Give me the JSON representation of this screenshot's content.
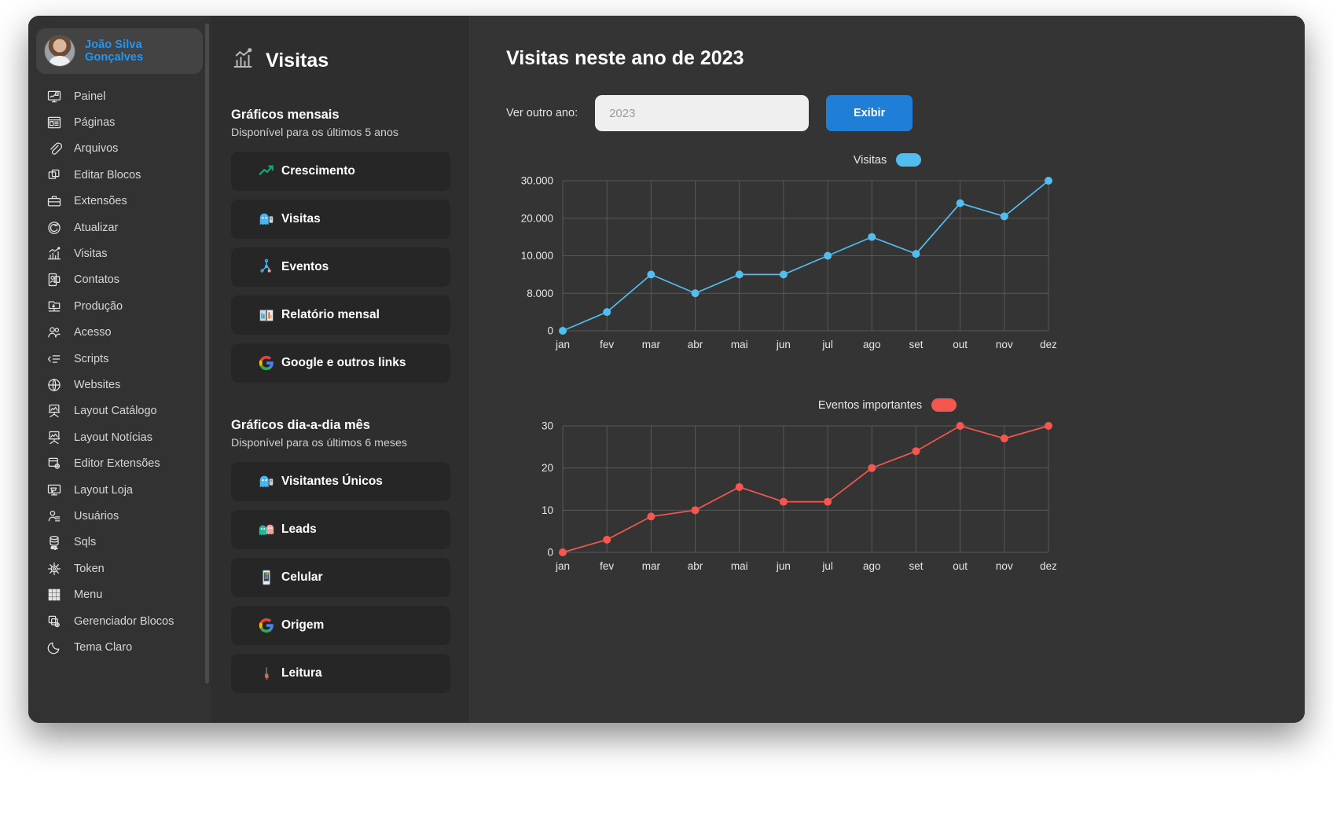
{
  "sidebar": {
    "profile": {
      "name": "João Silva Gonçalves",
      "avatar_alt": "user-avatar"
    },
    "items": [
      {
        "label": "Painel",
        "icon": "dashboard-icon"
      },
      {
        "label": "Páginas",
        "icon": "pages-icon"
      },
      {
        "label": "Arquivos",
        "icon": "paperclip-icon"
      },
      {
        "label": "Editar Blocos",
        "icon": "blocks-icon"
      },
      {
        "label": "Extensões",
        "icon": "toolbox-icon"
      },
      {
        "label": "Atualizar",
        "icon": "refresh-icon"
      },
      {
        "label": "Visitas",
        "icon": "chart-icon"
      },
      {
        "label": "Contatos",
        "icon": "contacts-icon"
      },
      {
        "label": "Produção",
        "icon": "production-icon"
      },
      {
        "label": "Acesso",
        "icon": "users-icon"
      },
      {
        "label": "Scripts",
        "icon": "code-icon"
      },
      {
        "label": "Websites",
        "icon": "globe-icon"
      },
      {
        "label": "Layout Catálogo",
        "icon": "easel-icon"
      },
      {
        "label": "Layout Notícias",
        "icon": "easel-news-icon"
      },
      {
        "label": "Editor Extensões",
        "icon": "extension-editor-icon"
      },
      {
        "label": "Layout Loja",
        "icon": "shop-icon"
      },
      {
        "label": "Usuários",
        "icon": "user-list-icon"
      },
      {
        "label": "Sqls",
        "icon": "database-icon"
      },
      {
        "label": "Token",
        "icon": "token-icon"
      },
      {
        "label": "Menu",
        "icon": "grid-icon"
      },
      {
        "label": "Gerenciador Blocos",
        "icon": "blocks-gear-icon"
      },
      {
        "label": "Tema Claro",
        "icon": "moon-icon"
      }
    ]
  },
  "mid": {
    "title": "Visitas",
    "title_icon": "chart-icon",
    "groups": [
      {
        "heading": "Gráficos mensais",
        "subheading": "Disponível para os últimos 5 anos",
        "buttons": [
          {
            "label": "Crescimento",
            "icon": "trend-up-icon"
          },
          {
            "label": "Visitas",
            "icon": "visitor-icon"
          },
          {
            "label": "Eventos",
            "icon": "events-icon"
          },
          {
            "label": "Relatório mensal",
            "icon": "report-icon"
          },
          {
            "label": "Google e outros links",
            "icon": "google-icon"
          }
        ]
      },
      {
        "heading": "Gráficos dia-a-dia mês",
        "subheading": "Disponível para os últimos 6 meses",
        "buttons": [
          {
            "label": "Visitantes Únicos",
            "icon": "visitor-icon"
          },
          {
            "label": "Leads",
            "icon": "leads-icon"
          },
          {
            "label": "Celular",
            "icon": "mobile-icon"
          },
          {
            "label": "Origem",
            "icon": "google-icon"
          },
          {
            "label": "Leitura",
            "icon": "reading-icon"
          }
        ]
      }
    ]
  },
  "main": {
    "title": "Visitas neste ano de 2023",
    "year_label": "Ver outro ano:",
    "year_value": "",
    "year_placeholder": "2023",
    "submit_label": "Exibir"
  },
  "colors": {
    "accent_blue": "#2196f3",
    "button_blue": "#1f7fd6",
    "series_visitas": "#52bdef",
    "series_eventos": "#f4574f",
    "panel": "#343434",
    "sidebar": "#323232"
  },
  "chart_data": [
    {
      "type": "line",
      "title": "Visitas",
      "legend": "Visitas",
      "legend_position": "top-center",
      "series_color": "#52bdef",
      "categories": [
        "jan",
        "fev",
        "mar",
        "abr",
        "mai",
        "jun",
        "jul",
        "ago",
        "set",
        "out",
        "nov",
        "dez"
      ],
      "values": [
        0,
        4000,
        9000,
        8000,
        9000,
        9000,
        10000,
        15000,
        10500,
        24000,
        20500,
        30000
      ],
      "ytick_labels": [
        "30.000",
        "20.000",
        "10.000",
        "8.000",
        "0"
      ],
      "ytick_values": [
        30000,
        20000,
        10000,
        8000,
        0
      ],
      "ylim": [
        0,
        32000
      ],
      "xlabel": "",
      "ylabel": "",
      "grid": true
    },
    {
      "type": "line",
      "title": "Eventos importantes",
      "legend": "Eventos importantes",
      "legend_position": "top-center",
      "series_color": "#f4574f",
      "categories": [
        "jan",
        "fev",
        "mar",
        "abr",
        "mai",
        "jun",
        "jul",
        "ago",
        "set",
        "out",
        "nov",
        "dez"
      ],
      "values": [
        0,
        3,
        8.5,
        10,
        15.5,
        12,
        12,
        20,
        24,
        30,
        27,
        30
      ],
      "ytick_labels": [
        "30",
        "20",
        "10",
        "0"
      ],
      "ytick_values": [
        30,
        20,
        10,
        0
      ],
      "ylim": [
        0,
        33
      ],
      "xlabel": "",
      "ylabel": "",
      "grid": true
    }
  ]
}
